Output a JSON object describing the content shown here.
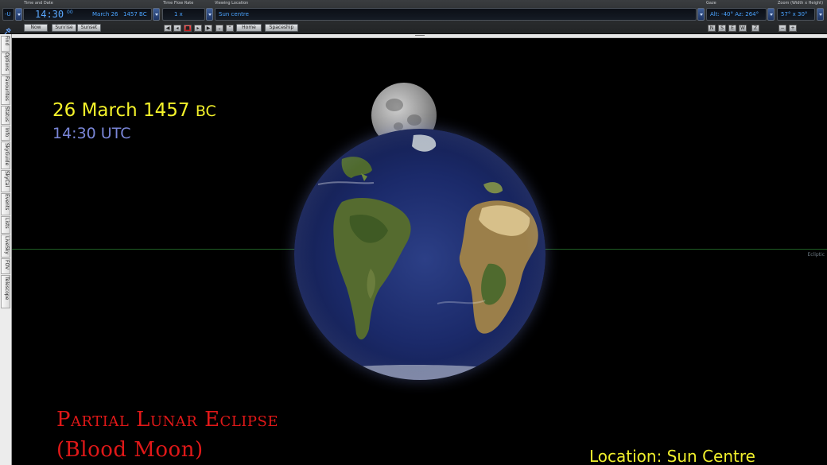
{
  "toolbar": {
    "time_date_label": "Time and Date",
    "time": "14:30",
    "seconds": "00",
    "date": "March 26",
    "year": "1457 BC",
    "timezone": "-U",
    "flow_label": "Time Flow Rate",
    "flow_value": "1 x",
    "location_label": "Viewing Location",
    "location_value": "Sun centre",
    "gaze_label": "Gaze",
    "gaze_value": "Alt: -40° Az: 264°",
    "zoom_label": "Zoom (Width x Height)",
    "zoom_value": "57° x 30°",
    "now": "Now",
    "sunrise": "Sunrise",
    "sunset": "Sunset",
    "home": "Home",
    "spaceship": "Spaceship",
    "dir_n": "N",
    "dir_s": "S",
    "dir_e": "E",
    "dir_w": "W",
    "dir_z": "Z",
    "zoom_out": "−",
    "zoom_in": "+"
  },
  "side_tabs": [
    "Find",
    "Options",
    "Favourites",
    "Status",
    "Info",
    "SkyGuide",
    "SkyCal",
    "Events",
    "Lists",
    "LiveSky",
    "FOV",
    "Telescope"
  ],
  "sky": {
    "ecliptic_label": "Ecliptic",
    "date_text": "26 March 1457",
    "era_text": "BC",
    "time_text": "14:30 UTC",
    "title_line1": "Partial Lunar Eclipse",
    "title_line2": "(Blood Moon)",
    "location_text": "Location: Sun Centre"
  },
  "colors": {
    "date": "#f4f22a",
    "time": "#7a86d8",
    "title": "#e01818",
    "location": "#f0ef2c",
    "ecliptic": "#1f5e24"
  }
}
